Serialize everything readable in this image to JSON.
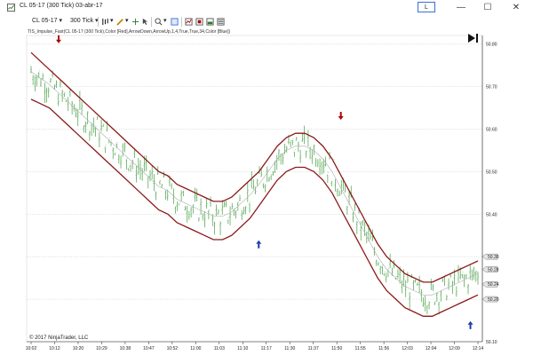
{
  "window": {
    "title": "CL 05-17 (300 Tick)  03-abr-17",
    "l_button": "L",
    "minimize": "—",
    "maximize": "☐",
    "close": "✕"
  },
  "toolbar": {
    "instrument": "CL 05-17",
    "interval": "300 Tick"
  },
  "indicator_label": "TIS_Impulse_Fast(CL 05-17 (300 Tick),Color [Red],ArrowDown,ArrowUp,1,4,True,True,34,Color [Blue])",
  "copyright": "© 2017 NinjaTrader, LLC",
  "price_ticks": [
    "50.80",
    "50.70",
    "50.60",
    "50.50",
    "50.40",
    "50.30",
    "50.20",
    "50.10"
  ],
  "price_tags": [
    "50.30",
    "50.28",
    "50.24",
    "50.20"
  ],
  "time_ticks": [
    "10:02",
    "10:12",
    "10:20",
    "10:29",
    "10:38",
    "10:47",
    "10:52",
    "11:00",
    "11:03",
    "11:10",
    "11:17",
    "11:30",
    "11:37",
    "11:50",
    "11:55",
    "11:56",
    "12:03",
    "12:04",
    "12:09",
    "12:14"
  ],
  "colors": {
    "bars": "#44a044",
    "bands": "#8b1a1a",
    "midline": "#b0b0b0",
    "arrow_down": "#b00000",
    "arrow_up": "#1a3aa8"
  },
  "chart_data": {
    "type": "line",
    "ylim": [
      50.1,
      50.82
    ],
    "series": [
      {
        "values": [
          50.77,
          50.75,
          50.73,
          50.71,
          50.69,
          50.67,
          50.65,
          50.63,
          50.61,
          50.59,
          50.57,
          50.55,
          50.53,
          50.51,
          50.49,
          50.48,
          50.46,
          50.45,
          50.44,
          50.43,
          50.42,
          50.42,
          50.43,
          50.45,
          50.47,
          50.49,
          50.52,
          50.55,
          50.57,
          50.58,
          50.58,
          50.57,
          50.55,
          50.52,
          50.48,
          50.44,
          50.4,
          50.36,
          50.32,
          50.29,
          50.27,
          50.25,
          50.24,
          50.23,
          50.23,
          50.24,
          50.25,
          50.26,
          50.27,
          50.28
        ]
      },
      {
        "values": [
          50.7,
          50.69,
          50.68,
          50.66,
          50.64,
          50.62,
          50.6,
          50.58,
          50.56,
          50.54,
          50.52,
          50.5,
          50.48,
          50.46,
          50.44,
          50.43,
          50.41,
          50.4,
          50.39,
          50.38,
          50.37,
          50.37,
          50.38,
          50.4,
          50.42,
          50.45,
          50.48,
          50.51,
          50.53,
          50.54,
          50.54,
          50.53,
          50.51,
          50.48,
          50.44,
          50.4,
          50.36,
          50.32,
          50.28,
          50.25,
          50.23,
          50.21,
          50.2,
          50.19,
          50.19,
          50.2,
          50.21,
          50.22,
          50.23,
          50.24
        ]
      }
    ],
    "arrows": [
      {
        "direction": "down",
        "time": "10:02",
        "price": 50.81
      },
      {
        "direction": "up",
        "time": "11:10",
        "price": 50.33
      },
      {
        "direction": "down",
        "time": "11:37",
        "price": 50.63
      },
      {
        "direction": "up",
        "time": "12:09",
        "price": 50.14
      }
    ]
  }
}
